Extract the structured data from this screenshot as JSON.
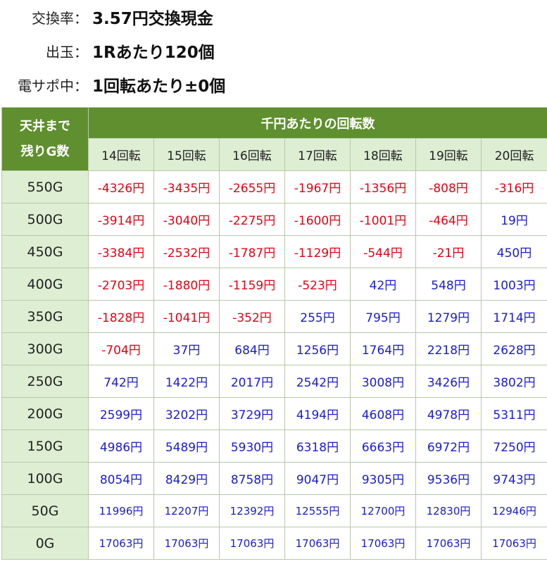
{
  "info": {
    "rate_label": "交換率：",
    "rate_value": "3.57円交換現金",
    "payout_label": "出玉：",
    "payout_value": "1Rあたり120個",
    "support_label": "電サポ中：",
    "support_value": "1回転あたり±0個"
  },
  "table": {
    "corner_line1": "天井まで",
    "corner_line2": "残りG数",
    "group_header": "千円あたりの回転数",
    "columns": [
      "14回転",
      "15回転",
      "16回転",
      "17回転",
      "18回転",
      "19回転",
      "20回転"
    ],
    "rows": [
      {
        "label": "550G",
        "values": [
          "-4326円",
          "-3435円",
          "-2655円",
          "-1967円",
          "-1356円",
          "-808円",
          "-316円"
        ]
      },
      {
        "label": "500G",
        "values": [
          "-3914円",
          "-3040円",
          "-2275円",
          "-1600円",
          "-1001円",
          "-464円",
          "19円"
        ]
      },
      {
        "label": "450G",
        "values": [
          "-3384円",
          "-2532円",
          "-1787円",
          "-1129円",
          "-544円",
          "-21円",
          "450円"
        ]
      },
      {
        "label": "400G",
        "values": [
          "-2703円",
          "-1880円",
          "-1159円",
          "-523円",
          "42円",
          "548円",
          "1003円"
        ]
      },
      {
        "label": "350G",
        "values": [
          "-1828円",
          "-1041円",
          "-352円",
          "255円",
          "795円",
          "1279円",
          "1714円"
        ]
      },
      {
        "label": "300G",
        "values": [
          "-704円",
          "37円",
          "684円",
          "1256円",
          "1764円",
          "2218円",
          "2628円"
        ]
      },
      {
        "label": "250G",
        "values": [
          "742円",
          "1422円",
          "2017円",
          "2542円",
          "3008円",
          "3426円",
          "3802円"
        ]
      },
      {
        "label": "200G",
        "values": [
          "2599円",
          "3202円",
          "3729円",
          "4194円",
          "4608円",
          "4978円",
          "5311円"
        ]
      },
      {
        "label": "150G",
        "values": [
          "4986円",
          "5489円",
          "5930円",
          "6318円",
          "6663円",
          "6972円",
          "7250円"
        ]
      },
      {
        "label": "100G",
        "values": [
          "8054円",
          "8429円",
          "8758円",
          "9047円",
          "9305円",
          "9536円",
          "9743円"
        ]
      },
      {
        "label": "50G",
        "values": [
          "11996円",
          "12207円",
          "12392円",
          "12555円",
          "12700円",
          "12830円",
          "12946円"
        ]
      },
      {
        "label": "0G",
        "values": [
          "17063円",
          "17063円",
          "17063円",
          "17063円",
          "17063円",
          "17063円",
          "17063円"
        ]
      }
    ]
  },
  "colors": {
    "header_green": "#5f8f2e",
    "light_green": "#ddeed3",
    "negative": "#e60012",
    "positive": "#1a1ad6"
  }
}
